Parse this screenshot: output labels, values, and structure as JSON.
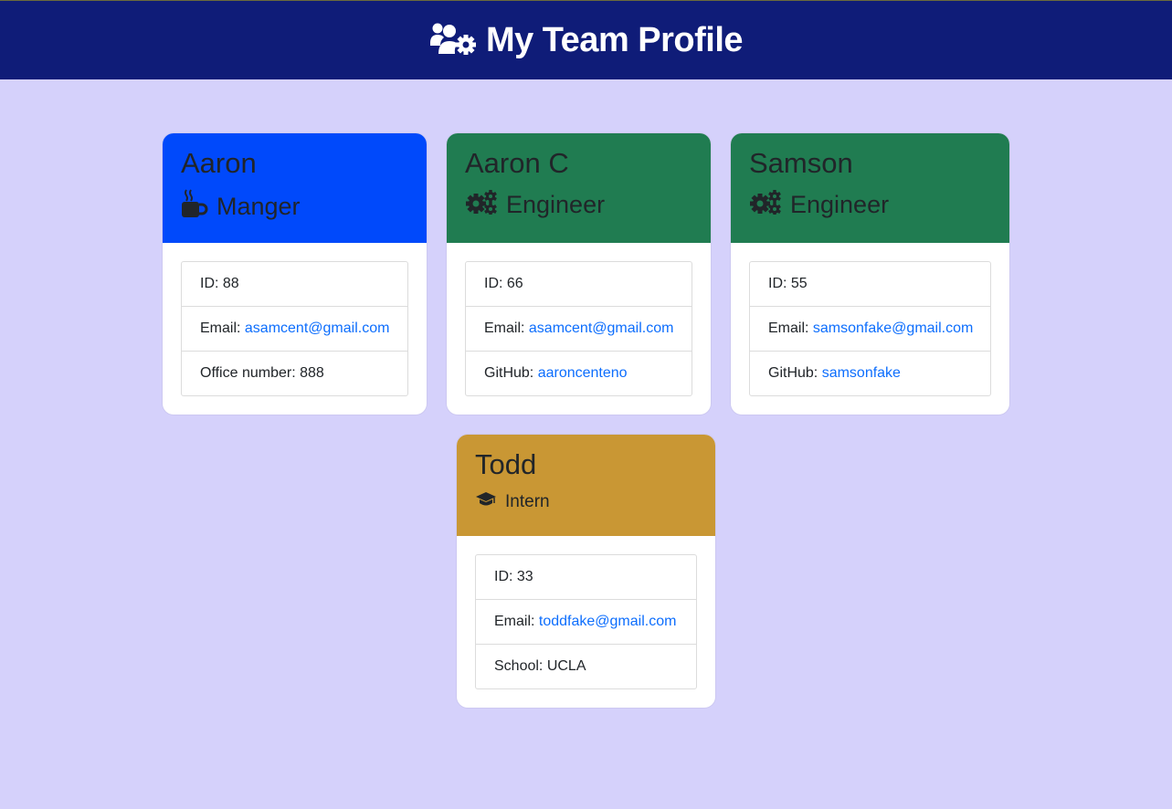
{
  "header": {
    "title": "My Team Profile",
    "icon": "users-gear-icon"
  },
  "colors": {
    "header_bg": "#0f1c78",
    "page_bg": "#d5d1fb",
    "manager": "#0049fb",
    "engineer": "#207c51",
    "intern": "#c99734",
    "link": "#0d6efd"
  },
  "cards": [
    {
      "name": "Aaron",
      "role": "Manger",
      "icon": "mug-hot-icon",
      "id_label": "ID: ",
      "id": "88",
      "email_label": "Email: ",
      "email": "asamcent@gmail.com",
      "extra_label": "Office number: ",
      "extra": "888"
    },
    {
      "name": "Aaron C",
      "role": "Engineer",
      "icon": "cogs-icon",
      "id_label": "ID: ",
      "id": "66",
      "email_label": "Email: ",
      "email": "asamcent@gmail.com",
      "extra_label": "GitHub: ",
      "extra": "aaroncenteno"
    },
    {
      "name": "Samson",
      "role": "Engineer",
      "icon": "cogs-icon",
      "id_label": "ID: ",
      "id": "55",
      "email_label": "Email: ",
      "email": "samsonfake@gmail.com",
      "extra_label": "GitHub: ",
      "extra": "samsonfake"
    },
    {
      "name": "Todd",
      "role": "Intern",
      "icon": "graduation-cap-icon",
      "id_label": "ID: ",
      "id": "33",
      "email_label": "Email: ",
      "email": "toddfake@gmail.com",
      "extra_label": "School: ",
      "extra": "UCLA"
    }
  ]
}
